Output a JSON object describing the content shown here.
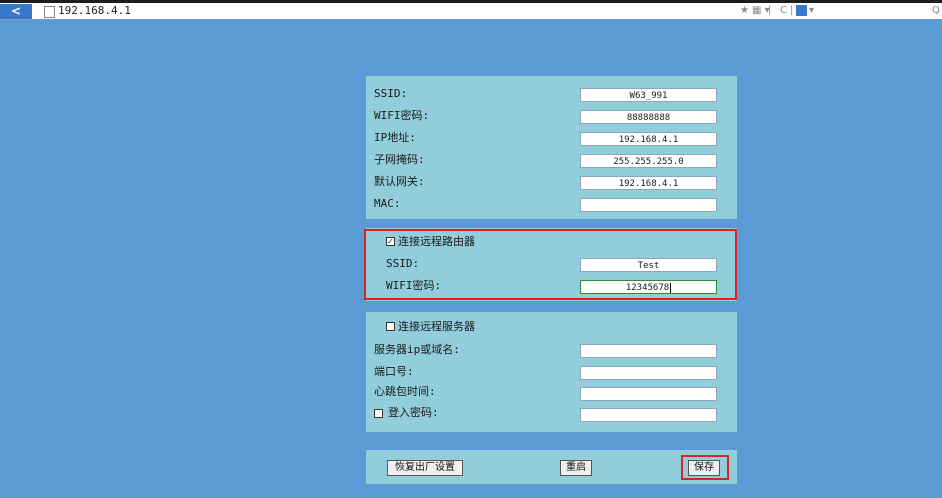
{
  "browser": {
    "back_glyph": "<",
    "url": "192.168.4.1",
    "toolbar": {
      "star": "★",
      "grid": "▦ ▾",
      "sep": "|",
      "refresh": "C",
      "search_drop": "▾",
      "search": "Q"
    },
    "icons": [
      "back-arrow-icon",
      "page-icon",
      "star-icon",
      "grid-icon",
      "refresh-icon",
      "search-engine-icon",
      "search-icon"
    ]
  },
  "wifi_settings": {
    "ssid_label": "SSID:",
    "ssid_value": "W63_991",
    "wifi_password_label": "WIFI密码:",
    "wifi_password_value": "88888888",
    "ip_label": "IP地址:",
    "ip_value": "192.168.4.1",
    "subnet_label": "子网掩码:",
    "subnet_value": "255.255.255.0",
    "gateway_label": "默认网关:",
    "gateway_value": "192.168.4.1",
    "mac_label": "MAC:",
    "mac_value": ""
  },
  "remote_router": {
    "checkbox_label": "连接远程路由器",
    "checked": true,
    "check_glyph": "✓",
    "ssid_label": "SSID:",
    "ssid_value": "Test",
    "password_label": "WIFI密码:",
    "password_value": "12345678"
  },
  "remote_server": {
    "checkbox_label": "连接远程服务器",
    "checked": false,
    "server_label": "服务器ip或域名:",
    "server_value": "",
    "port_label": "端口号:",
    "port_value": "",
    "heartbeat_label": "心跳包时间:",
    "heartbeat_value": "",
    "login_password_label": "登入密码:",
    "login_password_checked": false,
    "login_password_value": ""
  },
  "actions": {
    "restore_label": "恢复出厂设置",
    "restart_label": "重启",
    "save_label": "保存"
  },
  "colors": {
    "background": "#5b9bd5",
    "panel": "#92cddc",
    "highlight": "#d9241f",
    "active_border": "#2e8b3a"
  }
}
